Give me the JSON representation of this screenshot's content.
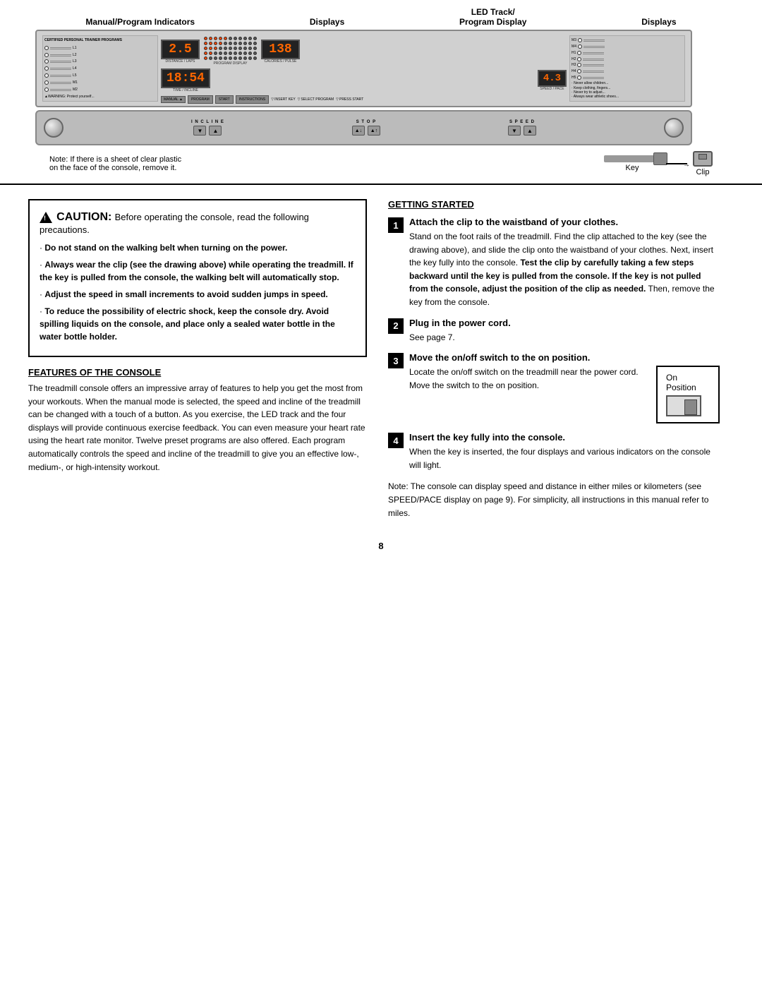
{
  "page": {
    "number": "8"
  },
  "diagram": {
    "labels": {
      "manual_program": "Manual/Program Indicators",
      "displays_left": "Displays",
      "led_track": "LED Track/\nProgram Display",
      "displays_right": "Displays"
    },
    "lcd_values": {
      "distance": "2.5",
      "time": "18:54",
      "calories": "138",
      "speed": "4.3"
    },
    "lcd_sublabels": {
      "distance": "DISTANCE / LAPS",
      "time": "TIME / INCLINE",
      "program": "PROGRAM DISPLAY",
      "calories": "CALORIES / PULSE",
      "speed": "SPEED / PACE"
    },
    "note_line1": "Note: If there is a sheet of clear plastic",
    "note_line2": "on the face of the console, remove it.",
    "key_label": "Key",
    "clip_label": "Clip",
    "control_labels": {
      "incline": "INCLINE",
      "stop": "STOP",
      "speed": "SPEED"
    },
    "button_labels": {
      "manual": "MANUAL",
      "program": "PROGRAM",
      "start": "START",
      "instructions": "INSTRUCTIONS",
      "insert_key": "INSERT KEY",
      "select_program": "SELECT PROGRAM",
      "press_start": "PRESS START"
    }
  },
  "caution": {
    "title_prefix": "CAUTION:",
    "title_text": "Before operating the console, read the following precautions.",
    "bullets": [
      {
        "text": "Do not stand on the walking belt when turning on the power.",
        "bold_part": "Do not stand on the walking belt when turning on the power."
      },
      {
        "text": "Always wear the clip (see the drawing above) while operating the treadmill. If the key is pulled from the console, the walking belt will automatically stop.",
        "bold_part": "Always wear the clip (see the drawing above) while operating the treadmill. If the key is pulled from the console, the walking belt will automatically stop."
      },
      {
        "text": "Adjust the speed in small increments to avoid sudden jumps in speed.",
        "bold_part": "Adjust the speed in small increments to avoid sudden jumps in speed."
      },
      {
        "text": "To reduce the possibility of electric shock, keep the console dry. Avoid spilling liquids on the console, and place only a sealed water bottle in the water bottle holder.",
        "bold_part": "To reduce the possibility of electric shock, keep the console dry. Avoid spilling liquids on the console, and place only a sealed water bottle in the water bottle holder."
      }
    ]
  },
  "features": {
    "header": "FEATURES OF THE CONSOLE",
    "text": "The treadmill console offers an impressive array of features to help you get the most from your workouts. When the manual mode is selected, the speed and incline of the treadmill can be changed with a touch of a button. As you exercise, the LED track and the four displays will provide continuous exercise feedback. You can even measure your heart rate using the heart rate monitor. Twelve preset programs are also offered. Each program automatically controls the speed and incline of the treadmill to give you an effective low-, medium-, or high-intensity workout."
  },
  "getting_started": {
    "header": "GETTING STARTED",
    "steps": [
      {
        "number": "1",
        "title": "Attach the clip to the waistband of your clothes.",
        "text": "Stand on the foot rails of the treadmill. Find the clip attached to the key (see the drawing above), and slide the clip onto the waistband of your clothes. Next, insert the key fully into the console. Test the clip by carefully taking a few steps backward until the key is pulled from the console. If the key is not pulled from the console, adjust the position of the clip as needed. Then, remove the key from the console.",
        "bold_parts": "Test the clip by carefully taking a few steps backward until the key is pulled from the console. If the key is not pulled from the console, adjust the position of the clip as needed."
      },
      {
        "number": "2",
        "title": "Plug in the power cord.",
        "text": "See page 7."
      },
      {
        "number": "3",
        "title": "Move the on/off switch to the on position.",
        "text": "Locate the on/off switch on the treadmill near the power cord. Move the switch to the on position.",
        "switch_label_on": "On",
        "switch_label_position": "Position"
      },
      {
        "number": "4",
        "title": "Insert the key fully into the console.",
        "text": "When the key is inserted, the four displays and various indicators on the console will light."
      }
    ],
    "note": "Note: The console can display speed and distance in either miles or kilometers (see SPEED/PACE display on page 9). For simplicity, all instructions in this manual refer to miles."
  }
}
